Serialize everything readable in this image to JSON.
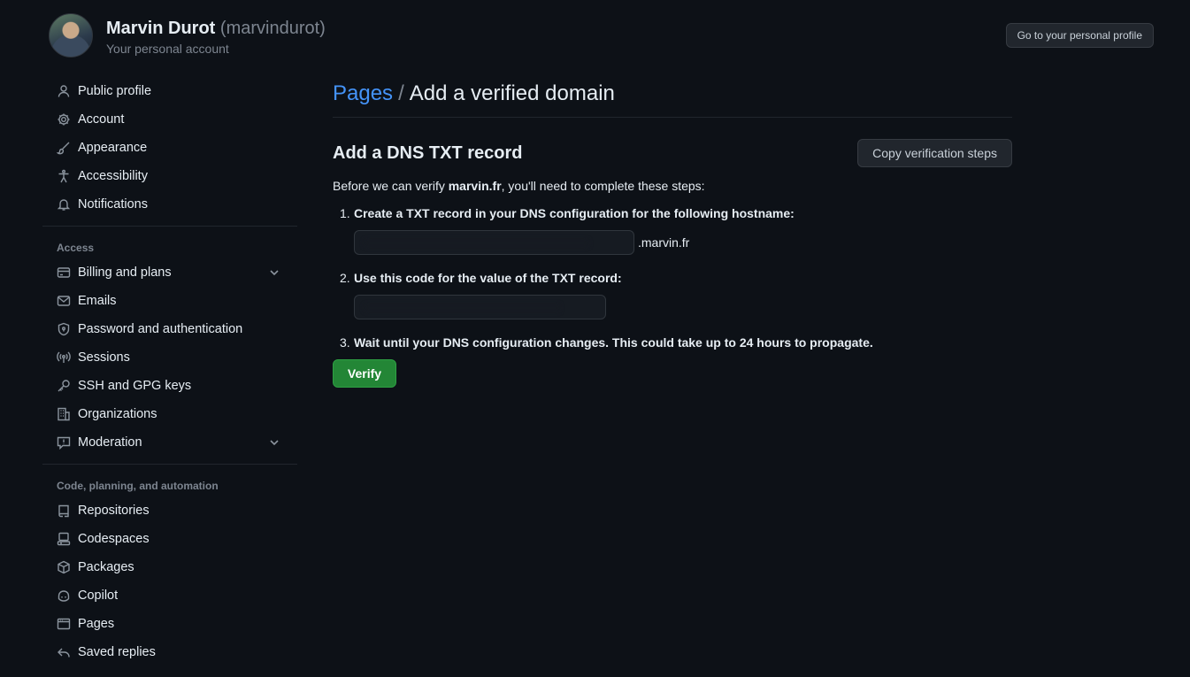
{
  "header": {
    "name": "Marvin Durot",
    "login": "(marvindurot)",
    "account_type": "Your personal account",
    "profile_button": "Go to your personal profile"
  },
  "sidebar": {
    "top_items": [
      {
        "label": "Public profile",
        "icon": "person-icon"
      },
      {
        "label": "Account",
        "icon": "gear-icon"
      },
      {
        "label": "Appearance",
        "icon": "paintbrush-icon"
      },
      {
        "label": "Accessibility",
        "icon": "accessibility-icon"
      },
      {
        "label": "Notifications",
        "icon": "bell-icon"
      }
    ],
    "access_title": "Access",
    "access_items": [
      {
        "label": "Billing and plans",
        "icon": "credit-card-icon",
        "expandable": true
      },
      {
        "label": "Emails",
        "icon": "mail-icon"
      },
      {
        "label": "Password and authentication",
        "icon": "shield-lock-icon"
      },
      {
        "label": "Sessions",
        "icon": "broadcast-icon"
      },
      {
        "label": "SSH and GPG keys",
        "icon": "key-icon"
      },
      {
        "label": "Organizations",
        "icon": "organization-icon"
      },
      {
        "label": "Moderation",
        "icon": "report-icon",
        "expandable": true
      }
    ],
    "code_title": "Code, planning, and automation",
    "code_items": [
      {
        "label": "Repositories",
        "icon": "repo-icon"
      },
      {
        "label": "Codespaces",
        "icon": "codespaces-icon"
      },
      {
        "label": "Packages",
        "icon": "package-icon"
      },
      {
        "label": "Copilot",
        "icon": "copilot-icon"
      },
      {
        "label": "Pages",
        "icon": "browser-icon"
      },
      {
        "label": "Saved replies",
        "icon": "reply-icon"
      }
    ]
  },
  "main": {
    "breadcrumb_parent": "Pages",
    "breadcrumb_separator": "/",
    "breadcrumb_current": "Add a verified domain",
    "section_heading": "Add a DNS TXT record",
    "copy_button": "Copy verification steps",
    "intro_before": "Before we can verify ",
    "intro_domain": "marvin.fr",
    "intro_after": ", you'll need to complete these steps:",
    "steps": [
      {
        "num": "1.",
        "text": "Create a TXT record in your DNS configuration for the following hostname:"
      },
      {
        "num": "2.",
        "text": "Use this code for the value of the TXT record:"
      },
      {
        "num": "3.",
        "text": "Wait until your DNS configuration changes. This could take up to 24 hours to propagate."
      }
    ],
    "hostname_suffix": ".marvin.fr",
    "verify_button": "Verify"
  },
  "colors": {
    "background": "#0d1117",
    "link": "#4493f8",
    "muted": "#7d8590",
    "verify_green": "#238636"
  }
}
